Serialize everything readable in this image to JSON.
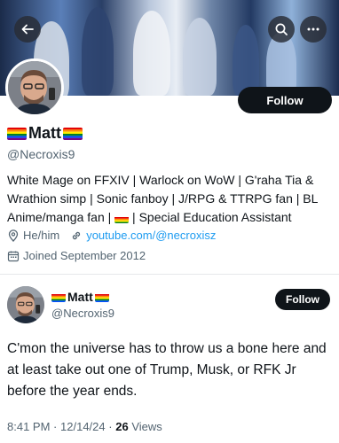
{
  "banner": {
    "back_icon": "arrow-left-icon",
    "search_icon": "search-icon",
    "more_icon": "more-horizontal-icon"
  },
  "profile": {
    "name": "Matt",
    "name_flag_icon": "rainbow-flag-icon",
    "handle": "@Necroxis9",
    "follow_label": "Follow",
    "bio": "White Mage on FFXIV | Warlock on WoW | G'raha Tia & Wrathion simp | Sonic fanboy | J/RPG & TTRPG fan | BL Anime/manga fan | 🏳️‍🌈 | Special Education Assistant",
    "bio_text_1": "White Mage on FFXIV | Warlock on WoW | G'raha Tia & Wrathion simp | Sonic fanboy | J/RPG & TTRPG fan | BL Anime/manga fan |",
    "bio_text_2": "| Special Education Assistant",
    "pronouns": "He/him",
    "link": "youtube.com/@necroxisz",
    "joined": "Joined September 2012"
  },
  "tweet": {
    "name": "Matt",
    "handle": "@Necroxis9",
    "follow_label": "Follow",
    "text": "C'mon the universe has to throw us a bone here and at least take out one of Trump, Musk, or RFK Jr before the year ends.",
    "time": "8:41 PM",
    "sep1": "·",
    "date": "12/14/24",
    "sep2": "·",
    "views_count": "26",
    "views_label": "Views"
  },
  "colors": {
    "text": "#0f1419",
    "secondary": "#536471",
    "link": "#1d9bf0",
    "button_bg": "#0f1419"
  }
}
